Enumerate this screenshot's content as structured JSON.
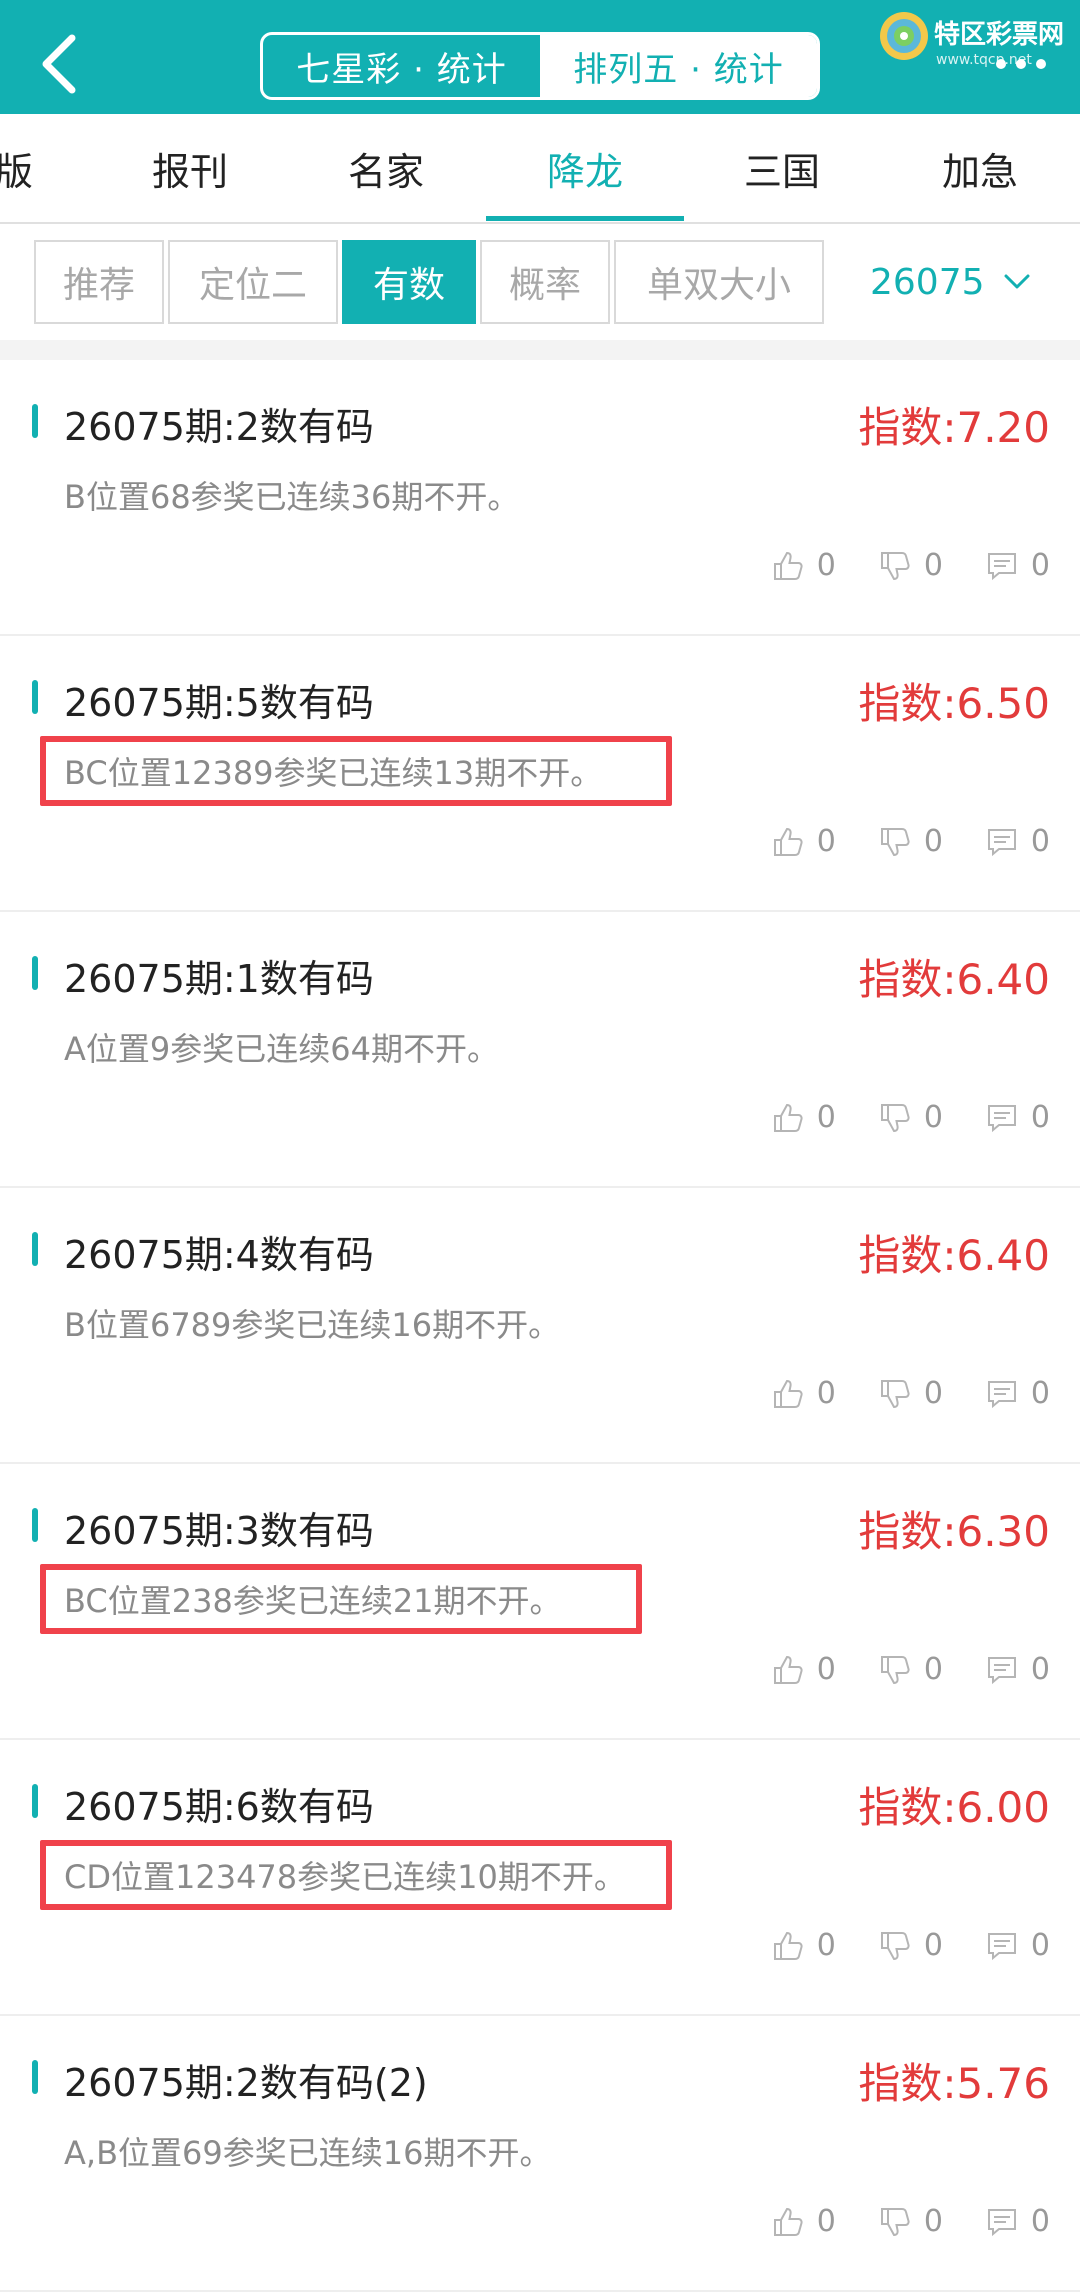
{
  "header": {
    "seg_items": [
      "七星彩 · 统计",
      "排列五 · 统计"
    ],
    "active_seg_index": 0,
    "logo_text": "特区彩票网",
    "logo_url": "www.tqcp.net"
  },
  "nav": {
    "items": [
      "版",
      "报刊",
      "名家",
      "降龙",
      "三国",
      "加急"
    ],
    "active_index": 3
  },
  "filters": {
    "items": [
      "推荐",
      "定位二",
      "有数",
      "概率",
      "单双大小"
    ],
    "active_index": 2,
    "issue": "26075"
  },
  "list": [
    {
      "title": "26075期:2数有码",
      "index": "指数:7.20",
      "desc": "B位置68参奖已连续36期不开。",
      "highlighted": false,
      "likes": "0",
      "dislikes": "0",
      "comments": "0"
    },
    {
      "title": "26075期:5数有码",
      "index": "指数:6.50",
      "desc": "BC位置12389参奖已连续13期不开。",
      "highlighted": true,
      "likes": "0",
      "dislikes": "0",
      "comments": "0"
    },
    {
      "title": "26075期:1数有码",
      "index": "指数:6.40",
      "desc": "A位置9参奖已连续64期不开。",
      "highlighted": false,
      "likes": "0",
      "dislikes": "0",
      "comments": "0"
    },
    {
      "title": "26075期:4数有码",
      "index": "指数:6.40",
      "desc": "B位置6789参奖已连续16期不开。",
      "highlighted": false,
      "likes": "0",
      "dislikes": "0",
      "comments": "0"
    },
    {
      "title": "26075期:3数有码",
      "index": "指数:6.30",
      "desc": "BC位置238参奖已连续21期不开。",
      "highlighted": true,
      "likes": "0",
      "dislikes": "0",
      "comments": "0"
    },
    {
      "title": "26075期:6数有码",
      "index": "指数:6.00",
      "desc": "CD位置123478参奖已连续10期不开。",
      "highlighted": true,
      "likes": "0",
      "dislikes": "0",
      "comments": "0"
    },
    {
      "title": "26075期:2数有码(2)",
      "index": "指数:5.76",
      "desc": "A,B位置69参奖已连续16期不开。",
      "highlighted": false,
      "likes": "0",
      "dislikes": "0",
      "comments": "0"
    }
  ],
  "colors": {
    "accent": "#12b0b2",
    "index_red": "#e23b3b",
    "highlight_box": "#f0424b"
  },
  "icons": {
    "back": "back-arrow-icon",
    "more": "more-dots-icon",
    "dropdown": "chevron-down-icon",
    "like": "thumb-up-icon",
    "dislike": "thumb-down-icon",
    "comment": "comment-icon"
  }
}
